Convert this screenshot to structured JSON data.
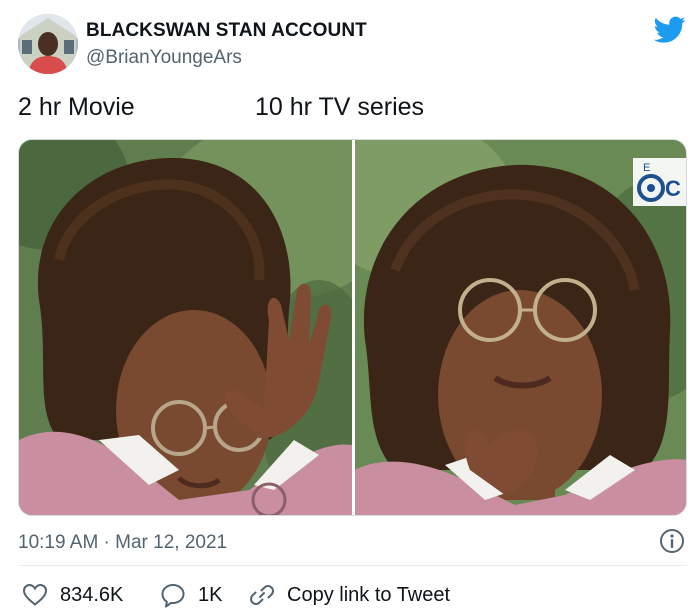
{
  "user": {
    "display_name": "BLACKSWAN STAN ACCOUNT",
    "handle": "@BrianYoungeArs"
  },
  "tweet": {
    "caption_left": "2 hr Movie",
    "caption_right": "10 hr TV series",
    "timestamp": "10:19 AM · Mar 12, 2021"
  },
  "media": {
    "left_panel": "photo-left",
    "right_panel": "photo-right",
    "watermark": "CBS"
  },
  "actions": {
    "like_count": "834.6K",
    "reply_count": "1K",
    "copy_link_label": "Copy link to Tweet"
  },
  "colors": {
    "brand": "#1d9bf0",
    "text": "#0f1419",
    "secondary": "#536471"
  },
  "icons": {
    "logo": "twitter-bird-icon",
    "info": "info-icon",
    "like": "heart-icon",
    "reply": "reply-icon",
    "copy": "link-icon"
  }
}
